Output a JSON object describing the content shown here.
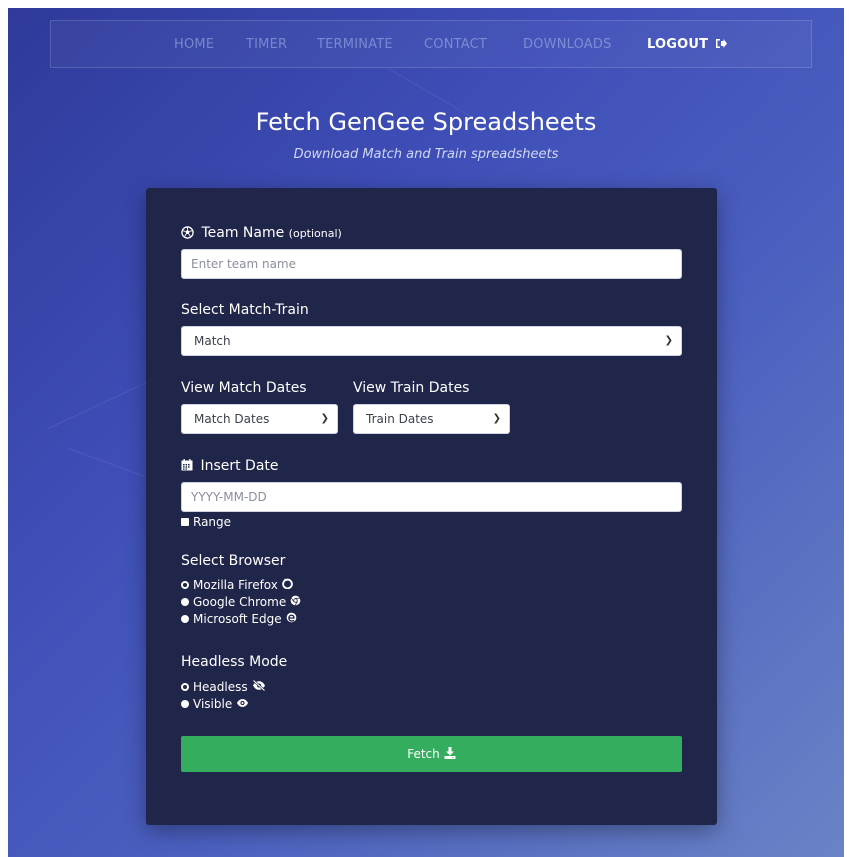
{
  "nav": {
    "items": [
      {
        "label": "HOME"
      },
      {
        "label": "TIMER"
      },
      {
        "label": "TERMINATE"
      },
      {
        "label": "CONTACT"
      },
      {
        "label": "DOWNLOADS"
      },
      {
        "label": "LOGOUT"
      }
    ],
    "logout_icon": "sign-out-icon"
  },
  "header": {
    "title": "Fetch GenGee Spreadsheets",
    "subtitle": "Download Match and Train spreadsheets"
  },
  "form": {
    "team": {
      "label": "Team Name",
      "optional": "(optional)",
      "placeholder": "Enter team name",
      "icon": "soccer-ball-icon"
    },
    "match_train": {
      "label": "Select Match-Train",
      "selected": "Match"
    },
    "match_dates": {
      "label": "View Match Dates",
      "selected": "Match Dates"
    },
    "train_dates": {
      "label": "View Train Dates",
      "selected": "Train Dates"
    },
    "date": {
      "label": "Insert Date",
      "placeholder": "YYYY-MM-DD",
      "icon": "calendar-icon",
      "range_label": "Range"
    },
    "browser": {
      "label": "Select Browser",
      "options": [
        {
          "label": "Mozilla Firefox",
          "icon": "firefox-icon",
          "checked": true
        },
        {
          "label": "Google Chrome",
          "icon": "chrome-icon",
          "checked": false
        },
        {
          "label": "Microsoft Edge",
          "icon": "edge-icon",
          "checked": false
        }
      ]
    },
    "headless": {
      "label": "Headless Mode",
      "options": [
        {
          "label": "Headless",
          "icon": "eye-slash-icon",
          "checked": true
        },
        {
          "label": "Visible",
          "icon": "eye-icon",
          "checked": false
        }
      ]
    },
    "submit": {
      "label": "Fetch",
      "icon": "download-icon",
      "color": "#35ad5e"
    }
  },
  "colors": {
    "card_bg": "#20254a",
    "accent_green": "#35ad5e"
  }
}
